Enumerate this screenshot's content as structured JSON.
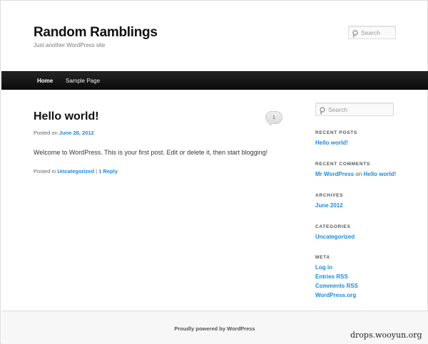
{
  "header": {
    "site_title": "Random Ramblings",
    "site_description": "Just another WordPress site",
    "search_placeholder": "Search"
  },
  "nav": {
    "items": [
      {
        "label": "Home"
      },
      {
        "label": "Sample Page"
      }
    ]
  },
  "post": {
    "title": "Hello world!",
    "posted_on_prefix": "Posted on",
    "date": "June 28, 2012",
    "comment_count": "1",
    "body": "Welcome to WordPress. This is your first post. Edit or delete it, then start blogging!",
    "posted_in_prefix": "Posted in",
    "category": "Uncategorized",
    "separator": "|",
    "reply_link": "1 Reply"
  },
  "sidebar": {
    "search_placeholder": "Search",
    "recent_posts": {
      "heading": "Recent Posts",
      "items": [
        "Hello world!"
      ]
    },
    "recent_comments": {
      "heading": "Recent Comments",
      "author": "Mr WordPress",
      "on": "on",
      "post": "Hello world!"
    },
    "archives": {
      "heading": "Archives",
      "items": [
        "June 2012"
      ]
    },
    "categories": {
      "heading": "Categories",
      "items": [
        "Uncategorized"
      ]
    },
    "meta": {
      "heading": "Meta",
      "items": [
        "Log in",
        "Entries RSS",
        "Comments RSS",
        "WordPress.org"
      ]
    }
  },
  "footer": {
    "text": "Proudly powered by WordPress"
  },
  "watermark": "drops.wooyun.org",
  "colors": {
    "link": "#1b8be0",
    "nav_bg": "#0a0a0a"
  }
}
